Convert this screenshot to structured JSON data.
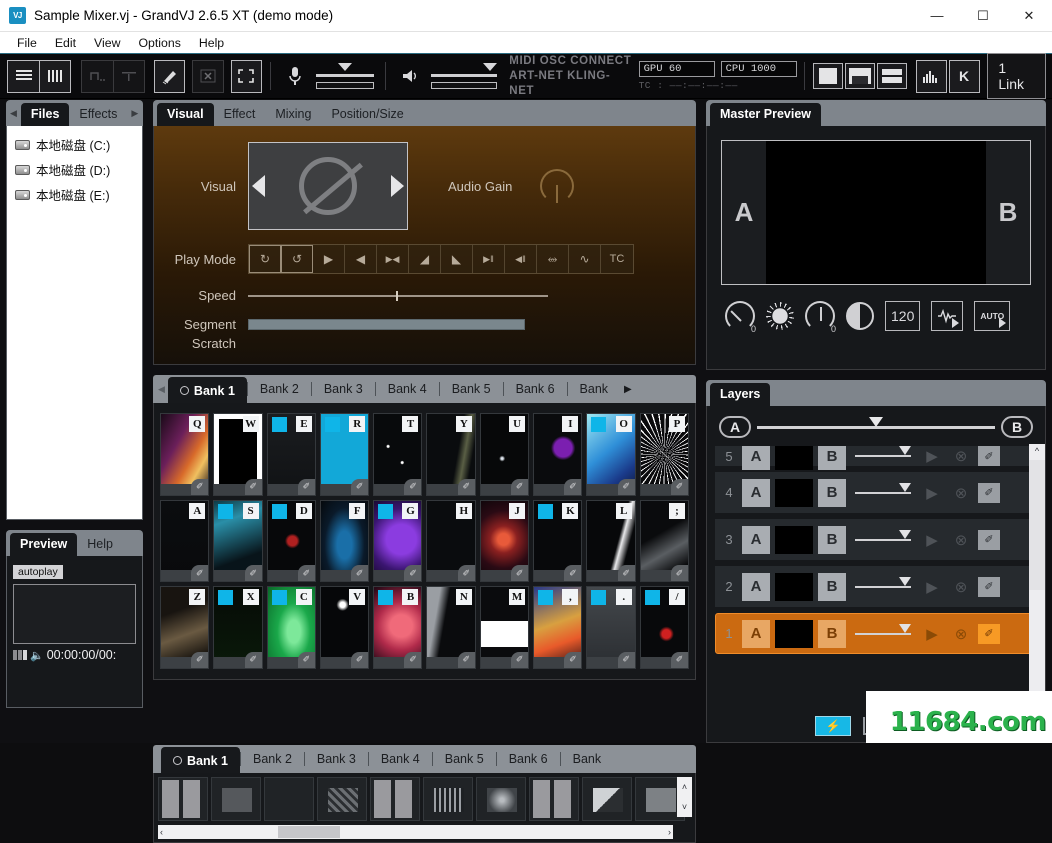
{
  "window": {
    "title": "Sample Mixer.vj - GrandVJ 2.6.5 XT (demo mode)",
    "icon_label": "VJ",
    "minimize": "—",
    "maximize": "☐",
    "close": "✕"
  },
  "menu": [
    "File",
    "Edit",
    "View",
    "Options",
    "Help"
  ],
  "toolbar": {
    "icons": [
      {
        "name": "list-view-icon",
        "glyph": "☰",
        "state": "active"
      },
      {
        "name": "grid-view-icon",
        "glyph": "⦀",
        "state": "active"
      },
      {
        "name": "step-edit-icon",
        "glyph": "⌐",
        "state": "disabled"
      },
      {
        "name": "timeline-icon",
        "glyph": "⏟",
        "state": "disabled"
      },
      {
        "name": "brush-icon",
        "glyph": "✐",
        "state": "enabled"
      },
      {
        "name": "clear-x-icon",
        "glyph": "X",
        "state": "disabled"
      },
      {
        "name": "fullscreen-icon",
        "glyph": "⤢",
        "state": "enabled"
      },
      {
        "name": "microphone-icon",
        "glyph": "Ἲ4",
        "state": "enabled"
      },
      {
        "name": "speaker-icon",
        "glyph": "ὐ8",
        "state": "enabled"
      }
    ],
    "protocols_line1": "MIDI  OSC  CONNECT",
    "protocols_line2": "ART-NET KLING-NET",
    "gpu_meter": "GPU  60",
    "cpu_meter": "CPU  1000",
    "timecode_label": "TC :",
    "timecode_value": "——:——:——:——",
    "layout_buttons": [
      "layout-single",
      "layout-split-horizontal",
      "layout-split-stacked"
    ],
    "eq_icon": "eq-bars-icon",
    "kling_icon": "kling-k-icon",
    "link_label": "1 Link"
  },
  "files_panel": {
    "tabs": [
      {
        "label": "Files",
        "active": true
      },
      {
        "label": "Effects",
        "active": false
      }
    ],
    "arrow_left": "◀",
    "arrow_right": "▶",
    "drives": [
      "本地磁盘 (C:)",
      "本地磁盘 (D:)",
      "本地磁盘 (E:)"
    ]
  },
  "preview_panel": {
    "tabs": [
      {
        "label": "Preview",
        "active": true
      },
      {
        "label": "Help",
        "active": false
      }
    ],
    "autoplay_label": "autoplay",
    "timecode": "00:00:00/00:"
  },
  "visual_panel": {
    "tabs": [
      {
        "label": "Visual",
        "active": true
      },
      {
        "label": "Effect",
        "active": false
      },
      {
        "label": "Mixing",
        "active": false
      },
      {
        "label": "Position/Size",
        "active": false
      }
    ],
    "visual_label": "Visual",
    "visual_value": "null",
    "audio_gain_label": "Audio Gain",
    "play_mode_label": "Play Mode",
    "play_modes": [
      {
        "name": "loop-forward-icon",
        "glyph": "↻",
        "framed": true
      },
      {
        "name": "loop-backward-icon",
        "glyph": "↺",
        "framed": true
      },
      {
        "name": "play-forward-icon",
        "glyph": "▶",
        "framed": false
      },
      {
        "name": "play-reverse-icon",
        "glyph": "◀",
        "framed": false
      },
      {
        "name": "ping-pong-icon",
        "glyph": "▶◀",
        "framed": false
      },
      {
        "name": "play-once-forward-icon",
        "glyph": "◢",
        "framed": false
      },
      {
        "name": "play-once-reverse-icon",
        "glyph": "◣",
        "framed": false
      },
      {
        "name": "play-pause-forward-icon",
        "glyph": "▶‖",
        "framed": false
      },
      {
        "name": "play-pause-reverse-icon",
        "glyph": "◀‖",
        "framed": false
      },
      {
        "name": "shuffle-icon",
        "glyph": "⤨",
        "framed": false
      },
      {
        "name": "waveform-icon",
        "glyph": "∿",
        "framed": false
      },
      {
        "name": "timecode-icon",
        "glyph": "TC",
        "framed": false
      }
    ],
    "speed_label": "Speed",
    "segment_label": "Segment",
    "scratch_label": "Scratch"
  },
  "bank_panel": {
    "tabs": [
      "Bank 1",
      "Bank 2",
      "Bank 3",
      "Bank 4",
      "Bank 5",
      "Bank 6",
      "Bank"
    ],
    "active_tab": "Bank 1",
    "arrow_left": "◀",
    "arrow_right": "▶",
    "clips": [
      {
        "key": "Q",
        "style": "sunset"
      },
      {
        "key": "W",
        "style": "whiteframe"
      },
      {
        "key": "E",
        "style": "grayblocks"
      },
      {
        "key": "R",
        "style": "yellowgrid"
      },
      {
        "key": "T",
        "style": "dots"
      },
      {
        "key": "Y",
        "style": "darkline"
      },
      {
        "key": "U",
        "style": "sparkle"
      },
      {
        "key": "I",
        "style": "purpleblob"
      },
      {
        "key": "O",
        "style": "cyanpaint"
      },
      {
        "key": "P",
        "style": "noise"
      },
      {
        "key": "A",
        "style": "graybar"
      },
      {
        "key": "S",
        "style": "tealsplash"
      },
      {
        "key": "D",
        "style": "redfigure"
      },
      {
        "key": "F",
        "style": "blueglow"
      },
      {
        "key": "G",
        "style": "violet"
      },
      {
        "key": "H",
        "style": "matrix"
      },
      {
        "key": "J",
        "style": "nebula"
      },
      {
        "key": "K",
        "style": "dashdark"
      },
      {
        "key": "L",
        "style": "whitestrip"
      },
      {
        "key": ";",
        "style": "smoke"
      },
      {
        "key": "Z",
        "style": "brownwave"
      },
      {
        "key": "X",
        "style": "greenwave"
      },
      {
        "key": "C",
        "style": "greenglow"
      },
      {
        "key": "V",
        "style": "burst"
      },
      {
        "key": "B",
        "style": "pinkblob"
      },
      {
        "key": "N",
        "style": "grayfade"
      },
      {
        "key": "M",
        "style": "whiteband"
      },
      {
        "key": ",",
        "style": "gradient"
      },
      {
        "key": ".",
        "style": "grayscreen"
      },
      {
        "key": "/",
        "style": "redsplat"
      }
    ]
  },
  "bank2_panel": {
    "tabs": [
      "Bank 1",
      "Bank 2",
      "Bank 3",
      "Bank 4",
      "Bank 5",
      "Bank 6",
      "Bank"
    ],
    "active_tab": "Bank 1",
    "scroll_left": "‹",
    "scroll_right": "›",
    "scroll_up": "˄",
    "scroll_down": "˅"
  },
  "master_panel": {
    "tab_label": "Master Preview",
    "side_a": "A",
    "side_b": "B",
    "controls": [
      {
        "name": "rotation-knob",
        "value": "0"
      },
      {
        "name": "brightness-knob",
        "value": ""
      },
      {
        "name": "saturation-knob",
        "value": "0"
      },
      {
        "name": "contrast-knob",
        "value": ""
      },
      {
        "name": "bpm-display",
        "value": "120"
      },
      {
        "name": "beat-waveform-button",
        "value": ""
      },
      {
        "name": "auto-button",
        "value": "AUTO"
      }
    ]
  },
  "layers_panel": {
    "tab_label": "Layers",
    "crossfader_a": "A",
    "crossfader_b": "B",
    "layers": [
      {
        "num": "5",
        "a": "A",
        "b": "B",
        "active": false,
        "clipped": true
      },
      {
        "num": "4",
        "a": "A",
        "b": "B",
        "active": false,
        "clipped": false
      },
      {
        "num": "3",
        "a": "A",
        "b": "B",
        "active": false,
        "clipped": false
      },
      {
        "num": "2",
        "a": "A",
        "b": "B",
        "active": false,
        "clipped": false
      },
      {
        "num": "1",
        "a": "A",
        "b": "B",
        "active": true,
        "clipped": false
      }
    ],
    "play_icon": "▶",
    "stop_icon": "⊗",
    "edit_icon": "✐",
    "flash_icon": "⚡"
  },
  "watermark": "11684.com"
}
